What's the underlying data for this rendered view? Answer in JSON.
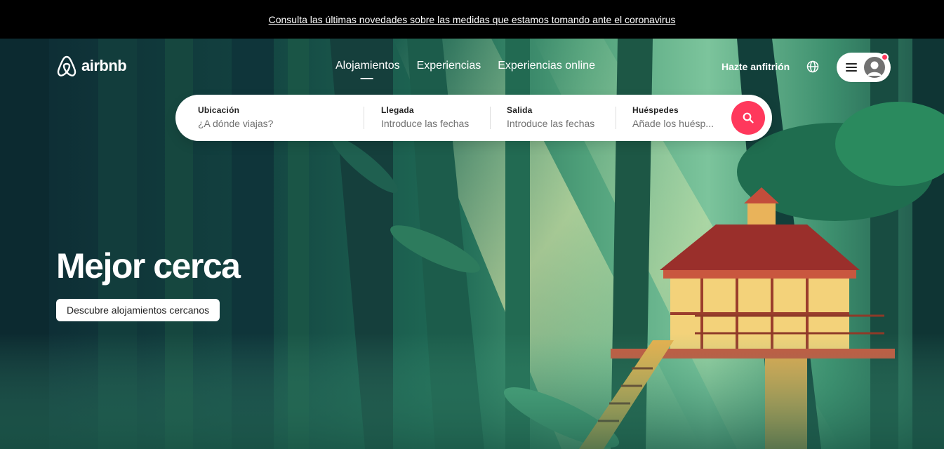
{
  "announcement": {
    "text": "Consulta las últimas novedades sobre las medidas que estamos tomando ante el coronavirus"
  },
  "header": {
    "logo_text": "airbnb",
    "tabs": [
      {
        "label": "Alojamientos",
        "active": true
      },
      {
        "label": "Experiencias",
        "active": false
      },
      {
        "label": "Experiencias online",
        "active": false
      }
    ],
    "host_link": "Hazte anfitrión",
    "globe_icon": "globe-icon",
    "menu_icon": "hamburger-icon",
    "avatar_icon": "user-avatar-icon",
    "has_notification": true
  },
  "search": {
    "location": {
      "label": "Ubicación",
      "placeholder": "¿A dónde viajas?"
    },
    "checkin": {
      "label": "Llegada",
      "placeholder": "Introduce las fechas"
    },
    "checkout": {
      "label": "Salida",
      "placeholder": "Introduce las fechas"
    },
    "guests": {
      "label": "Huéspedes",
      "placeholder": "Añade los huésp..."
    },
    "button_icon": "search-icon"
  },
  "hero": {
    "title": "Mejor cerca",
    "cta_label": "Descubre alojamientos cercanos",
    "image_description_icon": "treehouse-forest-illustration"
  },
  "colors": {
    "brand": "#ff385c",
    "announcement_bg": "#000000",
    "text_dark": "#222222",
    "text_muted": "#717171"
  }
}
